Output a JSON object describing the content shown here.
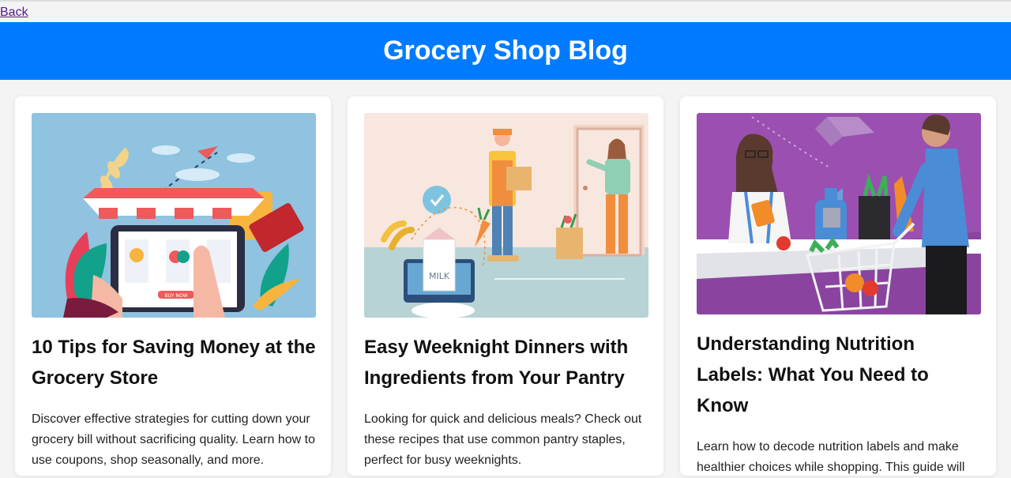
{
  "nav": {
    "back_label": "Back"
  },
  "header": {
    "title": "Grocery Shop Blog",
    "bg_color": "#007bff"
  },
  "posts": [
    {
      "title": "10 Tips for Saving Money at the Grocery Store",
      "excerpt": "Discover effective strategies for cutting down your grocery bill without sacrificing quality. Learn how to use coupons, shop seasonally, and more.",
      "image_label": "shop-tablet-illustration",
      "image_texts": {
        "sign": "BUY NOW"
      }
    },
    {
      "title": "Easy Weeknight Dinners with Ingredients from Your Pantry",
      "excerpt": "Looking for quick and delicious meals? Check out these recipes that use common pantry staples, perfect for busy weeknights.",
      "image_label": "delivery-illustration",
      "image_texts": {
        "carton": "MILK"
      }
    },
    {
      "title": "Understanding Nutrition Labels: What You Need to Know",
      "excerpt": "Learn how to decode nutrition labels and make healthier choices while shopping. This guide will",
      "image_label": "checkout-illustration",
      "image_texts": {}
    }
  ]
}
